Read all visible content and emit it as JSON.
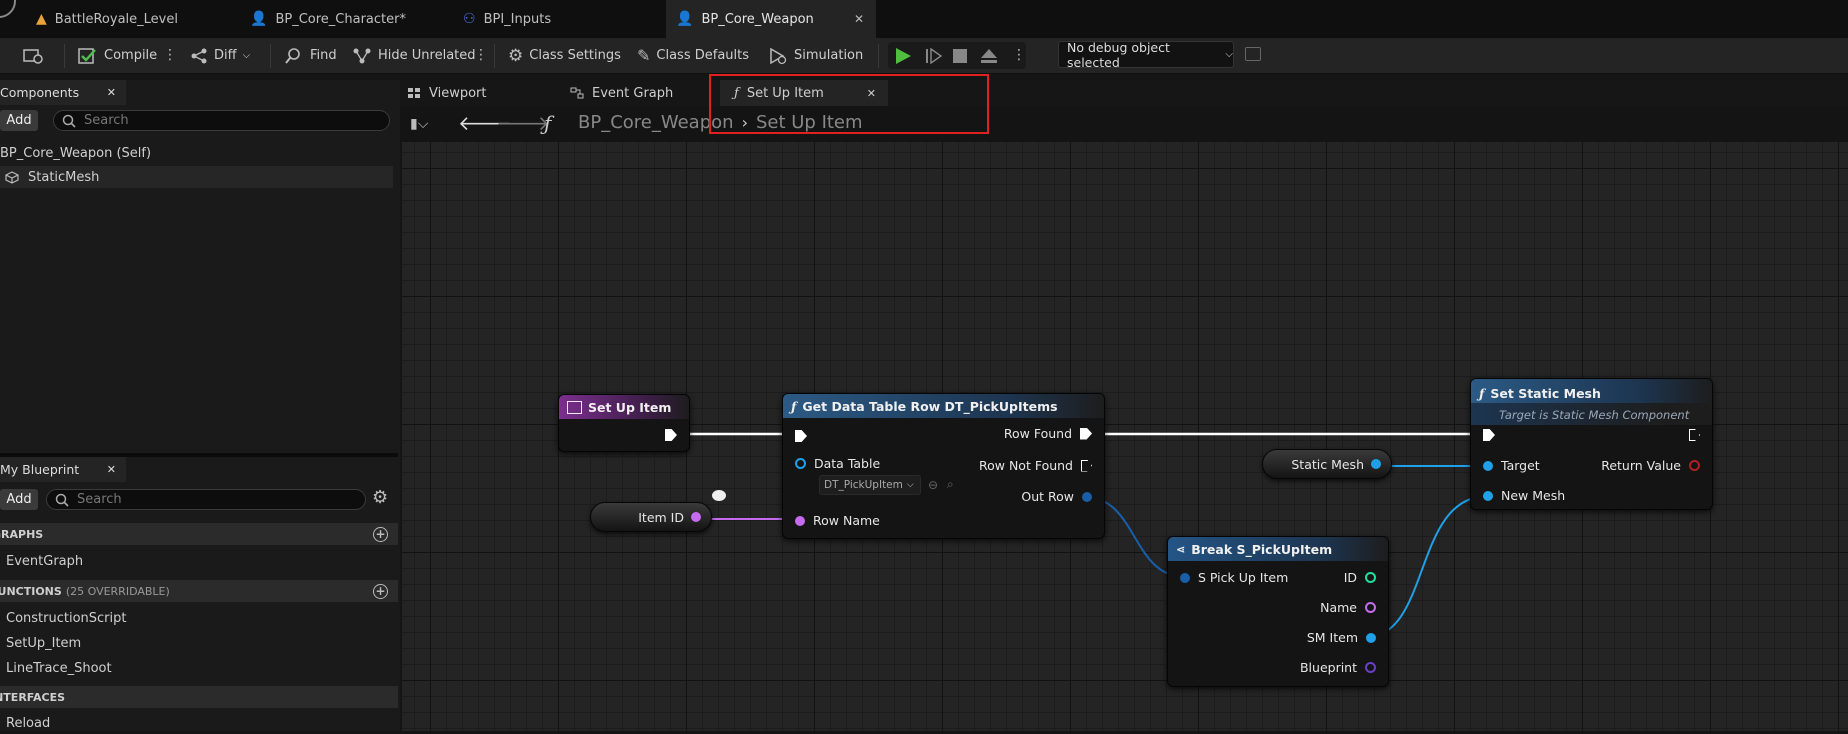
{
  "doc_tabs": [
    {
      "label": "BattleRoyale_Level"
    },
    {
      "label": "BP_Core_Character*"
    },
    {
      "label": "BPI_Inputs"
    },
    {
      "label": "BP_Core_Weapon",
      "close": "✕"
    }
  ],
  "toolbar": {
    "compile": "Compile",
    "diff": "Diff",
    "find": "Find",
    "hide_unrelated": "Hide Unrelated",
    "class_settings": "Class Settings",
    "class_defaults": "Class Defaults",
    "simulation": "Simulation",
    "debug_object": "No debug object selected"
  },
  "components": {
    "title": "Components",
    "close": "✕",
    "add": "Add",
    "search_placeholder": "Search",
    "items": [
      {
        "label": "BP_Core_Weapon (Self)"
      },
      {
        "label": "StaticMesh"
      }
    ]
  },
  "my_blueprint": {
    "title": "My Blueprint",
    "close": "✕",
    "add": "Add",
    "search_placeholder": "Search",
    "graphs_header": "GRAPHS",
    "graphs": [
      "EventGraph"
    ],
    "functions_header": "FUNCTIONS",
    "functions_count": "(25 OVERRIDABLE)",
    "functions": [
      "ConstructionScript",
      "SetUp_Item",
      "LineTrace_Shoot"
    ],
    "interfaces_header": "INTERFACES",
    "interfaces": [
      "Reload"
    ]
  },
  "graph_tabs": [
    {
      "label": "Viewport"
    },
    {
      "label": "Event Graph"
    },
    {
      "label": "Set Up Item",
      "close": "✕"
    }
  ],
  "breadcrumb": {
    "root": "BP_Core_Weapon",
    "current": "Set Up Item"
  },
  "nodes": {
    "entry": {
      "title": "Set Up Item"
    },
    "get_row": {
      "title": "Get Data Table Row DT_PickUpItems",
      "data_table": "Data Table",
      "table_value": "DT_PickUpItem",
      "row_name": "Row Name",
      "row_found": "Row Found",
      "row_not_found": "Row Not Found",
      "out_row": "Out Row"
    },
    "item_id": {
      "label": "Item ID"
    },
    "static_mesh_var": {
      "label": "Static Mesh"
    },
    "break": {
      "title": "Break S_PickUpItem",
      "input": "S Pick Up Item",
      "id": "ID",
      "name": "Name",
      "sm_item": "SM Item",
      "blueprint": "Blueprint"
    },
    "set_static_mesh": {
      "title": "Set Static Mesh",
      "subtitle": "Target is Static Mesh Component",
      "target": "Target",
      "new_mesh": "New Mesh",
      "return_value": "Return Value"
    }
  },
  "colors": {
    "accent_tab": "#e32020",
    "exec": "#ffffff",
    "object_pin": "#1fa0e8",
    "name_pin": "#c66bf0",
    "struct_pin": "#1a5ea8",
    "int_pin": "#1ee0a0",
    "class_pin": "#6b3ec8"
  }
}
